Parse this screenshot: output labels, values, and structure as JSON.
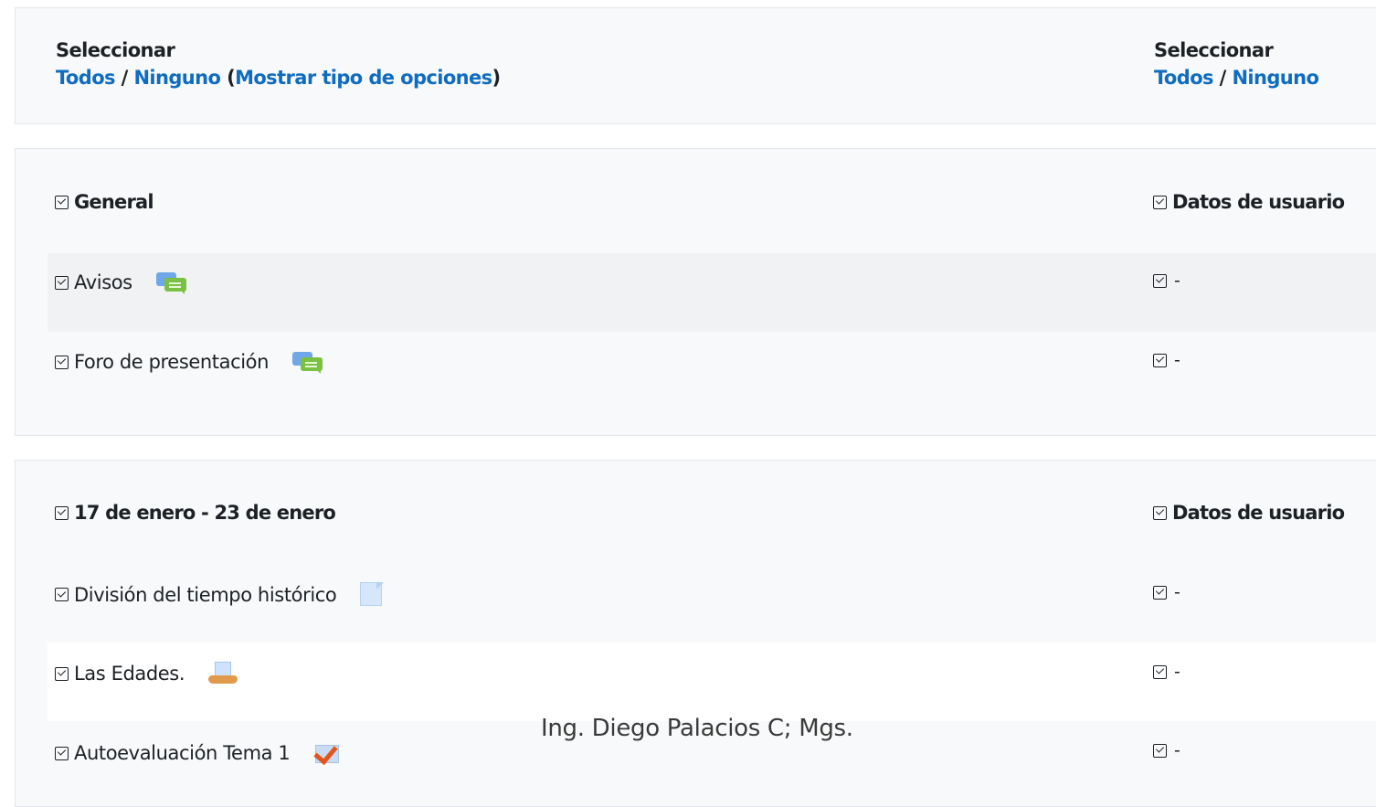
{
  "select_bar": {
    "left": {
      "label": "Seleccionar",
      "all": "Todos",
      "separator": "/",
      "none": "Ninguno",
      "paren_open": "(",
      "options": "Mostrar tipo de opciones",
      "paren_close": ")"
    },
    "right": {
      "label": "Seleccionar",
      "all": "Todos",
      "separator": "/",
      "none": "Ninguno"
    }
  },
  "sections": [
    {
      "title": "General",
      "userdata_label": "Datos de usuario",
      "items": [
        {
          "label": "Avisos",
          "icon": "forum-icon",
          "userdata": "-"
        },
        {
          "label": "Foro de presentación",
          "icon": "forum-icon",
          "userdata": "-"
        }
      ]
    },
    {
      "title": "17 de enero - 23 de enero",
      "userdata_label": "Datos de usuario",
      "items": [
        {
          "label": "División del tiempo histórico",
          "icon": "file-icon",
          "userdata": "-"
        },
        {
          "label": "Las Edades.",
          "icon": "book-icon",
          "userdata": "-"
        },
        {
          "label": "Autoevaluación Tema 1",
          "icon": "quiz-icon",
          "userdata": "-"
        }
      ]
    }
  ],
  "watermark": "Ing. Diego Palacios C; Mgs.",
  "colors": {
    "link": "#0f6cbf",
    "panel_bg": "#f8f9fa",
    "row_grey": "#f1f2f3"
  }
}
